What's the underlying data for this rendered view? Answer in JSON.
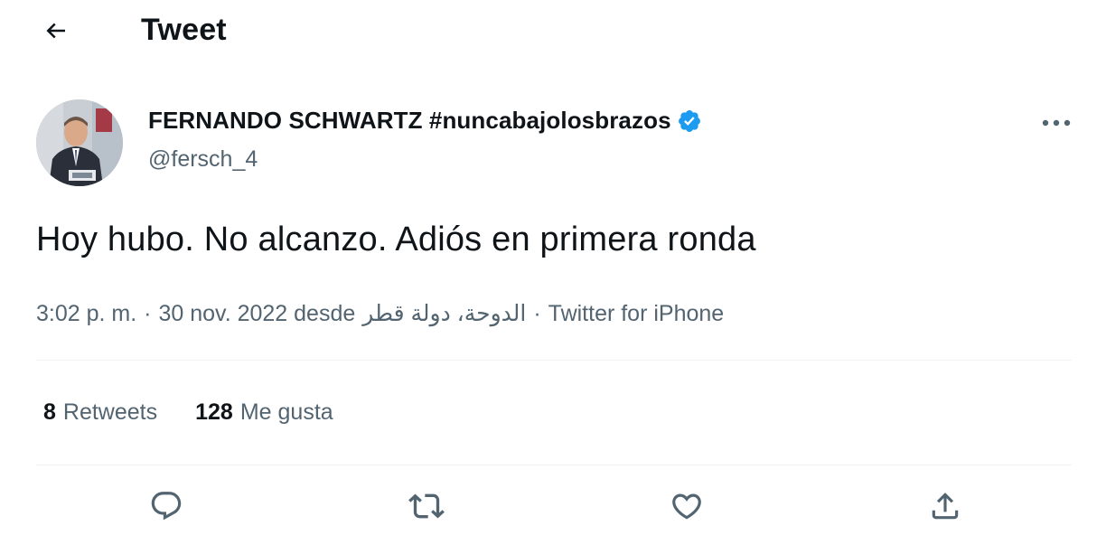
{
  "header": {
    "title": "Tweet",
    "back_icon": "arrow-left-icon"
  },
  "author": {
    "name": "FERNANDO SCHWARTZ #nuncabajolosbrazos",
    "handle": "@fersch_4",
    "verified_icon": "verified-badge-icon",
    "avatar_icon": "avatar"
  },
  "tweet": {
    "text": "Hoy hubo. No alcanzo. Adiós en primera ronda",
    "time": "3:02 p. m.",
    "separator": "·",
    "date_prefix": "30 nov. 2022 desde",
    "location": "الدوحة، دولة قطر",
    "source": "Twitter for iPhone"
  },
  "stats": {
    "retweets_count": "8",
    "retweets_label": "Retweets",
    "likes_count": "128",
    "likes_label": "Me gusta"
  },
  "actions": [
    {
      "icon": "reply-icon"
    },
    {
      "icon": "retweet-icon"
    },
    {
      "icon": "like-icon"
    },
    {
      "icon": "share-icon"
    }
  ],
  "colors": {
    "text_primary": "#0f1419",
    "text_secondary": "#536471",
    "verified": "#1d9bf0",
    "divider": "#eff3f4"
  }
}
